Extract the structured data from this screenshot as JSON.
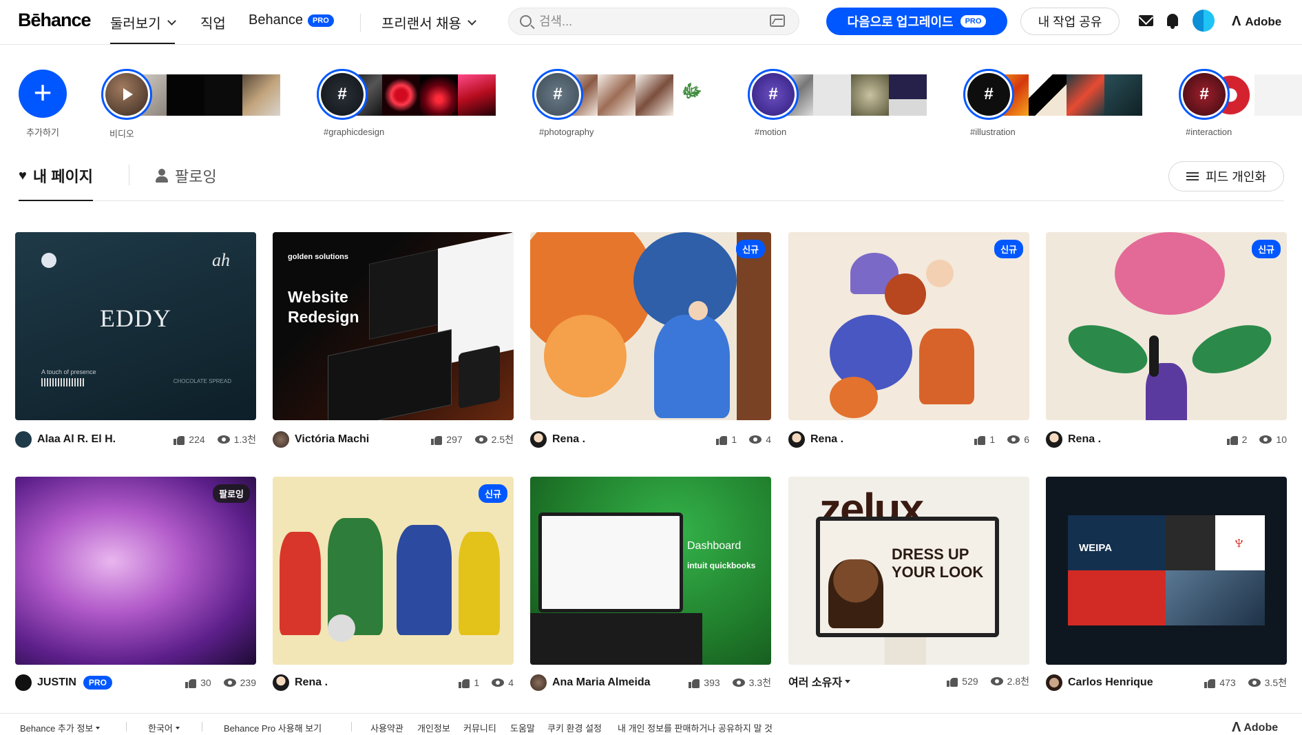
{
  "nav": {
    "logo": "Bēhance",
    "explore": "둘러보기",
    "jobs": "직업",
    "behance_pro": "Behance",
    "pro_badge": "PRO",
    "hire": "프리랜서 채용",
    "search_placeholder": "검색...",
    "upgrade": "다음으로 업그레이드",
    "share_work": "내 작업 공유",
    "adobe": "Adobe"
  },
  "stories": {
    "add_label": "추가하기",
    "items": [
      {
        "label": "비디오",
        "icon": "play-icon"
      },
      {
        "label": "#graphicdesign",
        "icon": "#"
      },
      {
        "label": "#photography",
        "icon": "#"
      },
      {
        "label": "#motion",
        "icon": "#"
      },
      {
        "label": "#illustration",
        "icon": "#"
      },
      {
        "label": "#interaction",
        "icon": "#"
      }
    ]
  },
  "feed": {
    "my_page": "내 페이지",
    "following": "팔로잉",
    "personalize": "피드 개인화"
  },
  "projects": [
    {
      "owner": "Alaa Al R. El H.",
      "likes": "224",
      "views": "1.3천",
      "badge": "",
      "thumb_title": "EDDY",
      "thumb_brand": "ah",
      "thumb_small": "A touch of presence",
      "thumb_tag": "CHOCOLATE SPREAD"
    },
    {
      "owner": "Victória Machi",
      "likes": "297",
      "views": "2.5천",
      "badge": "",
      "thumb_title": "Website Redesign",
      "thumb_brand": "golden solutions"
    },
    {
      "owner": "Rena .",
      "likes": "1",
      "views": "4",
      "badge": "신규"
    },
    {
      "owner": "Rena .",
      "likes": "1",
      "views": "6",
      "badge": "신규"
    },
    {
      "owner": "Rena .",
      "likes": "2",
      "views": "10",
      "badge": "신규"
    },
    {
      "owner": "JUSTIN",
      "owner_pro": "PRO",
      "likes": "30",
      "views": "239",
      "badge": "팔로잉"
    },
    {
      "owner": "Rena .",
      "likes": "1",
      "views": "4",
      "badge": "신규"
    },
    {
      "owner": "Ana Maria Almeida",
      "likes": "393",
      "views": "3.3천",
      "badge": "",
      "thumb_title": "Dashboard",
      "thumb_brand": "intuit quickbooks"
    },
    {
      "owner": "여러 소유자",
      "likes": "529",
      "views": "2.8천",
      "badge": "",
      "thumb_title": "zelux",
      "thumb_small": "DRESS UP YOUR LOOK"
    },
    {
      "owner": "Carlos Henrique",
      "likes": "473",
      "views": "3.5천",
      "badge": "",
      "thumb_title": "WEIPA"
    }
  ],
  "footer": {
    "more_info": "Behance 추가 정보",
    "language": "한국어",
    "pro_view": "Behance Pro 사용해 보기",
    "terms": "사용약관",
    "privacy": "개인정보",
    "community": "커뮤니티",
    "help": "도움말",
    "cookie": "쿠키 환경 설정",
    "do_not_sell": "내 개인 정보를 판매하거나 공유하지 말 것",
    "adobe": "Adobe"
  },
  "colors": {
    "accent": "#0057ff",
    "text": "#191919",
    "muted": "#555555"
  }
}
